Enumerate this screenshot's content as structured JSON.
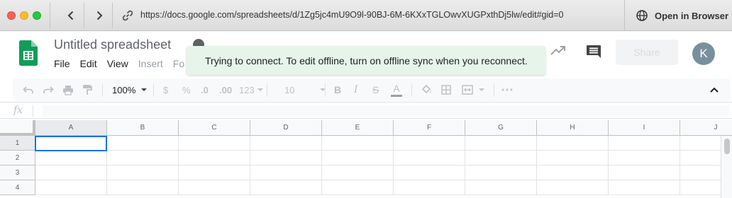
{
  "browser": {
    "url": "https://docs.google.com/spreadsheets/d/1Zg5jc4mU9O9l-90BJ-6M-6KXxTGLOwvXUGPxthDj5lw/edit#gid=0",
    "open_in_browser": "Open in Browser"
  },
  "header": {
    "title": "Untitled spreadsheet",
    "menus": [
      "File",
      "Edit",
      "View",
      "Insert",
      "Fo"
    ],
    "share_label": "Share",
    "avatar_initial": "K"
  },
  "toast": {
    "message": "Trying to connect. To edit offline, turn on offline sync when you reconnect."
  },
  "toolbar": {
    "zoom": "100%",
    "currency": "$",
    "percent": "%",
    "decrease_decimals": ".0",
    "increase_decimals": ".00",
    "more_formats": "123",
    "font_size": "10",
    "bold": "B",
    "italic": "I",
    "strikethrough": "S",
    "text_color": "A",
    "more": "⋯"
  },
  "formula_bar": {
    "fx_label": "fx"
  },
  "grid": {
    "columns": [
      "A",
      "B",
      "C",
      "D",
      "E",
      "F",
      "G",
      "H",
      "I",
      "J"
    ],
    "rows": [
      "1",
      "2",
      "3",
      "4"
    ],
    "selected_cell": "A1"
  },
  "colors": {
    "sheets_green": "#0f9d58",
    "toast_bg": "#e6f4ea",
    "selection_blue": "#1a73e8",
    "avatar_bg": "#78909c"
  }
}
